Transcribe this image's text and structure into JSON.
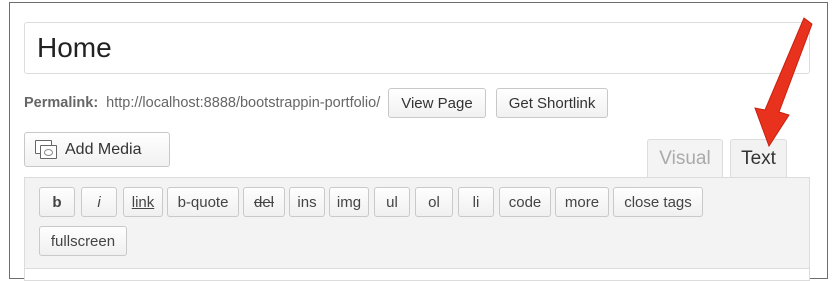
{
  "title_field": {
    "value": "Home"
  },
  "permalink": {
    "label": "Permalink:",
    "url": "http://localhost:8888/bootstrappin-portfolio/",
    "view_page_label": "View Page",
    "get_shortlink_label": "Get Shortlink"
  },
  "add_media": {
    "label": "Add Media",
    "icon": "media-icon"
  },
  "tabs": [
    {
      "label": "Visual",
      "active": false
    },
    {
      "label": "Text",
      "active": true
    }
  ],
  "quicktags": [
    {
      "label": "b"
    },
    {
      "label": "i"
    },
    {
      "label": "link"
    },
    {
      "label": "b-quote"
    },
    {
      "label": "del"
    },
    {
      "label": "ins"
    },
    {
      "label": "img"
    },
    {
      "label": "ul"
    },
    {
      "label": "ol"
    },
    {
      "label": "li"
    },
    {
      "label": "code"
    },
    {
      "label": "more"
    },
    {
      "label": "close tags"
    },
    {
      "label": "fullscreen"
    }
  ],
  "annotation": {
    "icon": "red-arrow",
    "color": "#e8321e"
  }
}
